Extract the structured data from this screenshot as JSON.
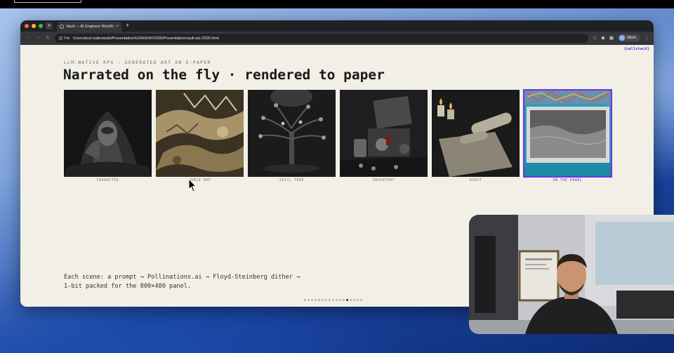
{
  "browser": {
    "tab_title": "Vault — AI Engineer World's Fair",
    "new_tab_icon": "+",
    "address_chip": "File",
    "url": "/Users/lech.kalinowski/Presentation%20AIEWF2026/Presentation/vault-aie-2026.html",
    "profile_label": "Work"
  },
  "page": {
    "corner_link": "{callstack}",
    "eyebrow": "LLM-NATIVE RPG · GENERATED ART ON E-PAPER",
    "headline": "Narrated on the fly · rendered to paper",
    "cards": [
      {
        "caption": "CHARACTER"
      },
      {
        "caption": "WORLD MAP"
      },
      {
        "caption": "SKILL TREE"
      },
      {
        "caption": "INVENTORY"
      },
      {
        "caption": "QUEST"
      },
      {
        "caption": "ON THE PANEL"
      }
    ],
    "footer_line1": "Each scene: a prompt → Pollinations.ai → Floyd-Steinberg dither →",
    "footer_line2": "1-bit packed for the 800×480 panel.",
    "slide_dots_total": 17,
    "slide_current": 13,
    "accent_color": "#6f35e0"
  }
}
